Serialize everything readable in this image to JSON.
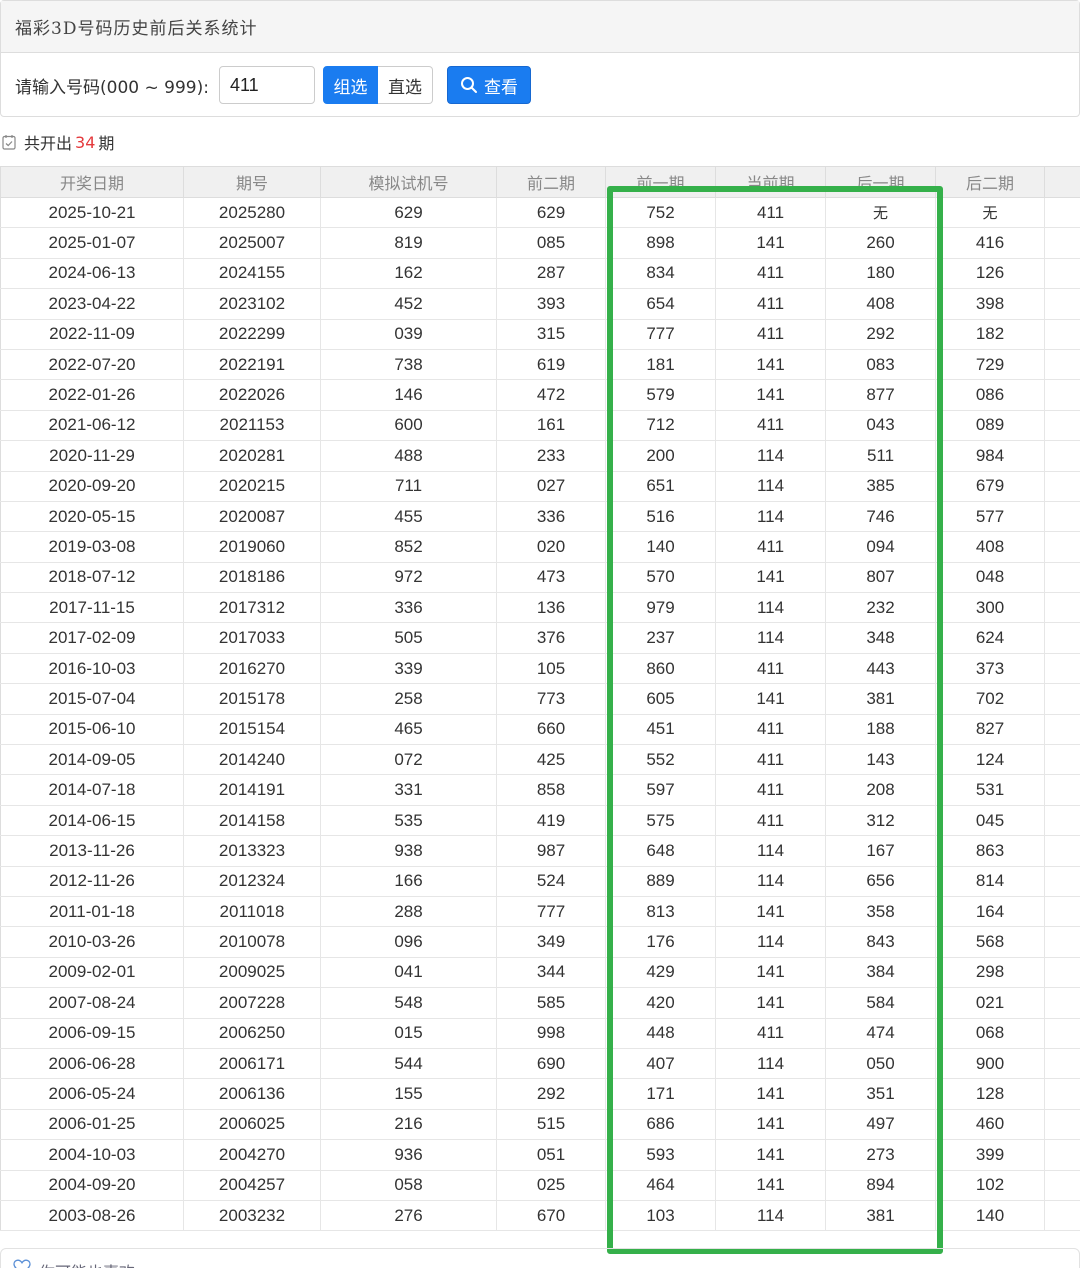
{
  "header": {
    "title": "福彩3D号码历史前后关系统计"
  },
  "query": {
    "label": "请输入号码(000 ~ 999):",
    "input_value": "411",
    "option_group": "组选",
    "option_direct": "直选",
    "search_button": "查看"
  },
  "summary": {
    "prefix": "共开出",
    "count": "34",
    "suffix": "期"
  },
  "table": {
    "headers": [
      "开奖日期",
      "期号",
      "模拟试机号",
      "前二期",
      "前一期",
      "当前期",
      "后一期",
      "后二期"
    ],
    "rows": [
      [
        "2025-10-21",
        "2025280",
        "629",
        "629",
        "752",
        "411",
        "无",
        "无"
      ],
      [
        "2025-01-07",
        "2025007",
        "819",
        "085",
        "898",
        "141",
        "260",
        "416"
      ],
      [
        "2024-06-13",
        "2024155",
        "162",
        "287",
        "834",
        "411",
        "180",
        "126"
      ],
      [
        "2023-04-22",
        "2023102",
        "452",
        "393",
        "654",
        "411",
        "408",
        "398"
      ],
      [
        "2022-11-09",
        "2022299",
        "039",
        "315",
        "777",
        "411",
        "292",
        "182"
      ],
      [
        "2022-07-20",
        "2022191",
        "738",
        "619",
        "181",
        "141",
        "083",
        "729"
      ],
      [
        "2022-01-26",
        "2022026",
        "146",
        "472",
        "579",
        "141",
        "877",
        "086"
      ],
      [
        "2021-06-12",
        "2021153",
        "600",
        "161",
        "712",
        "411",
        "043",
        "089"
      ],
      [
        "2020-11-29",
        "2020281",
        "488",
        "233",
        "200",
        "114",
        "511",
        "984"
      ],
      [
        "2020-09-20",
        "2020215",
        "711",
        "027",
        "651",
        "114",
        "385",
        "679"
      ],
      [
        "2020-05-15",
        "2020087",
        "455",
        "336",
        "516",
        "114",
        "746",
        "577"
      ],
      [
        "2019-03-08",
        "2019060",
        "852",
        "020",
        "140",
        "411",
        "094",
        "408"
      ],
      [
        "2018-07-12",
        "2018186",
        "972",
        "473",
        "570",
        "141",
        "807",
        "048"
      ],
      [
        "2017-11-15",
        "2017312",
        "336",
        "136",
        "979",
        "114",
        "232",
        "300"
      ],
      [
        "2017-02-09",
        "2017033",
        "505",
        "376",
        "237",
        "114",
        "348",
        "624"
      ],
      [
        "2016-10-03",
        "2016270",
        "339",
        "105",
        "860",
        "411",
        "443",
        "373"
      ],
      [
        "2015-07-04",
        "2015178",
        "258",
        "773",
        "605",
        "141",
        "381",
        "702"
      ],
      [
        "2015-06-10",
        "2015154",
        "465",
        "660",
        "451",
        "411",
        "188",
        "827"
      ],
      [
        "2014-09-05",
        "2014240",
        "072",
        "425",
        "552",
        "411",
        "143",
        "124"
      ],
      [
        "2014-07-18",
        "2014191",
        "331",
        "858",
        "597",
        "411",
        "208",
        "531"
      ],
      [
        "2014-06-15",
        "2014158",
        "535",
        "419",
        "575",
        "411",
        "312",
        "045"
      ],
      [
        "2013-11-26",
        "2013323",
        "938",
        "987",
        "648",
        "114",
        "167",
        "863"
      ],
      [
        "2012-11-26",
        "2012324",
        "166",
        "524",
        "889",
        "114",
        "656",
        "814"
      ],
      [
        "2011-01-18",
        "2011018",
        "288",
        "777",
        "813",
        "141",
        "358",
        "164"
      ],
      [
        "2010-03-26",
        "2010078",
        "096",
        "349",
        "176",
        "114",
        "843",
        "568"
      ],
      [
        "2009-02-01",
        "2009025",
        "041",
        "344",
        "429",
        "141",
        "384",
        "298"
      ],
      [
        "2007-08-24",
        "2007228",
        "548",
        "585",
        "420",
        "141",
        "584",
        "021"
      ],
      [
        "2006-09-15",
        "2006250",
        "015",
        "998",
        "448",
        "411",
        "474",
        "068"
      ],
      [
        "2006-06-28",
        "2006171",
        "544",
        "690",
        "407",
        "114",
        "050",
        "900"
      ],
      [
        "2006-05-24",
        "2006136",
        "155",
        "292",
        "171",
        "141",
        "351",
        "128"
      ],
      [
        "2006-01-25",
        "2006025",
        "216",
        "515",
        "686",
        "141",
        "497",
        "460"
      ],
      [
        "2004-10-03",
        "2004270",
        "936",
        "051",
        "593",
        "141",
        "273",
        "399"
      ],
      [
        "2004-09-20",
        "2004257",
        "058",
        "025",
        "464",
        "141",
        "894",
        "102"
      ],
      [
        "2003-08-26",
        "2003232",
        "276",
        "670",
        "103",
        "114",
        "381",
        "140"
      ]
    ]
  },
  "bottom": {
    "label": "你可能也喜欢"
  },
  "colors": {
    "primary": "#1a7cf0",
    "highlight": "#35b04a",
    "count_red": "#e4393c"
  },
  "icons": {
    "search": "search-icon",
    "calendar": "calendar-check-icon",
    "heart": "heart-icon"
  }
}
